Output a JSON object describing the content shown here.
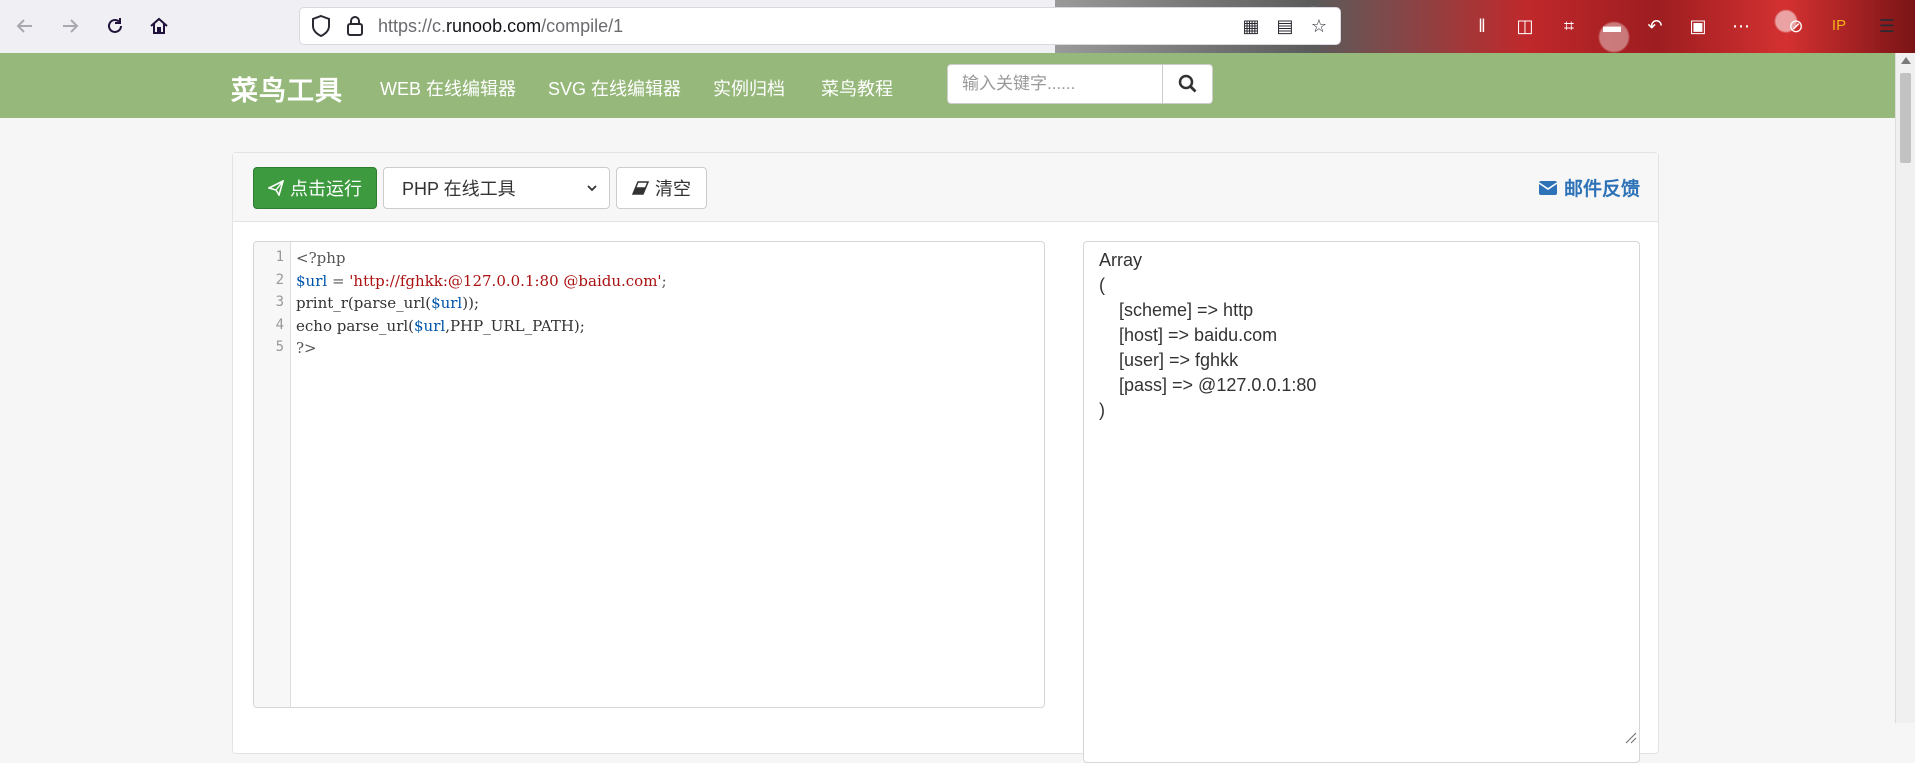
{
  "browser": {
    "url_prefix": "https://c.",
    "url_domain": "runoob.com",
    "url_path": "/compile/1"
  },
  "site": {
    "logo": "菜鸟工具",
    "nav": [
      "WEB 在线编辑器",
      "SVG 在线编辑器",
      "实例归档",
      "菜鸟教程"
    ],
    "search_placeholder": "输入关键字......"
  },
  "toolbar": {
    "run_label": "点击运行",
    "language": "PHP 在线工具",
    "clear_label": "清空",
    "feedback_label": "邮件反馈"
  },
  "editor": {
    "line_numbers": [
      "1",
      "2",
      "3",
      "4",
      "5"
    ]
  },
  "output": {
    "lines": [
      "Array",
      "(",
      "    [scheme] => http",
      "    [host] => baidu.com",
      "    [user] => fghkk",
      "    [pass] => @127.0.0.1:80",
      ")"
    ]
  },
  "colors": {
    "header": "#96b97b",
    "run_button": "#3d9a3e",
    "feedback": "#2e73b8"
  }
}
